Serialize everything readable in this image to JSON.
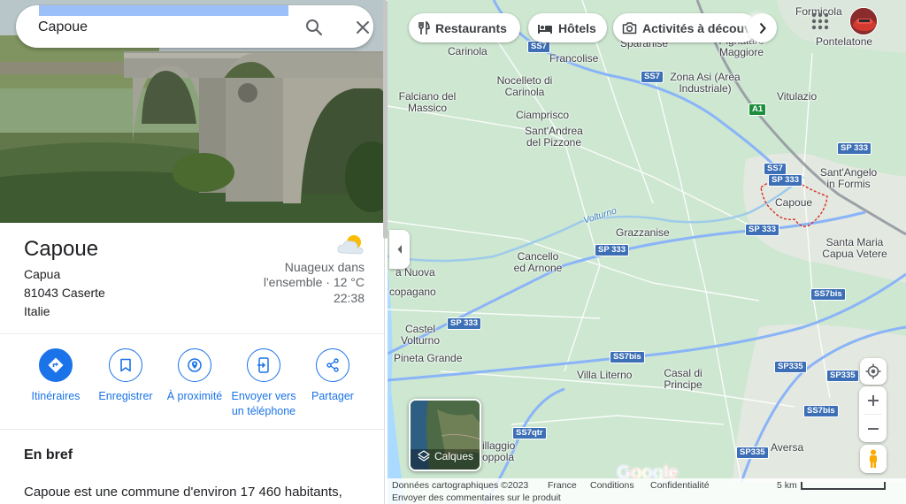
{
  "search": {
    "value": "Capoue"
  },
  "place": {
    "title": "Capoue",
    "address_line1": "Capua",
    "address_line2": "81043 Caserte",
    "address_line3": "Italie"
  },
  "weather": {
    "condition": "Nuageux dans l'ensemble · 12 °C",
    "time": "22:38"
  },
  "actions": [
    {
      "label": "Itinéraires",
      "icon": "directions-icon"
    },
    {
      "label": "Enregistrer",
      "icon": "bookmark-icon"
    },
    {
      "label": "À proximité",
      "icon": "nearby-icon"
    },
    {
      "label": "Envoyer vers un téléphone",
      "icon": "send-to-phone-icon"
    },
    {
      "label": "Partager",
      "icon": "share-icon"
    }
  ],
  "overview": {
    "title": "En bref",
    "text": "Capoue est une commune d'environ 17 460 habitants,"
  },
  "chips": [
    {
      "label": "Restaurants",
      "icon": "fork-knife-icon"
    },
    {
      "label": "Hôtels",
      "icon": "bed-icon"
    },
    {
      "label": "Activités à découvrir",
      "icon": "camera-icon"
    }
  ],
  "map": {
    "labels": {
      "formicola": "Formicola",
      "pontelatone": "Pontelatone",
      "sparanise": "Sparanise",
      "pignataro": "Pignataro Maggiore",
      "carinola": "Carinola",
      "francolise": "Francolise",
      "nocelleto": "Nocelleto di Carinola",
      "zona_asi": "Zona Asi (Area Industriale)",
      "falciano": "Falciano del Massico",
      "vitulazio": "Vitulazio",
      "ciamprisco": "Ciamprisco",
      "sant_andrea": "Sant'Andrea del Pizzone",
      "sant_angelo": "Sant'Angelo in Formis",
      "capoue": "Capoue",
      "volturno_river": "Volturno",
      "grazzanise": "Grazzanise",
      "santa_maria": "Santa Maria Capua Vetere",
      "cancello": "Cancello ed Arnone",
      "nuova": "a Nuova",
      "copagano": "copagano",
      "castel_volturno": "Castel Volturno",
      "pineta_grande": "Pineta Grande",
      "villa_literno": "Villa Literno",
      "casal_principe": "Casal di Principe",
      "villaggio_coppola": "illaggio oppola",
      "aversa": "Aversa"
    },
    "roads": {
      "ss7_a": "SS7",
      "ss7_b": "SS7",
      "ss7_c": "SS7",
      "a1": "A1",
      "sp333_a": "SP 333",
      "sp333_b": "SP 333",
      "sp333_c": "SP 333",
      "sp333_d": "SP 333",
      "sp333_e": "SP 333",
      "ss7bis_a": "SS7bis",
      "ss7bis_b": "SS7bis",
      "ss7bis_c": "SS7bis",
      "sp335_a": "SP335",
      "sp335_b": "SP335",
      "sp335_c": "SP335",
      "ss7qtr": "SS7qtr"
    }
  },
  "layers": {
    "label": "Calques"
  },
  "logo": "Google",
  "footer": {
    "data": "Données cartographiques ©2023",
    "country": "France",
    "conditions": "Conditions",
    "privacy": "Confidentialité",
    "feedback": "Envoyer des commentaires sur le produit",
    "scale": "5 km"
  }
}
